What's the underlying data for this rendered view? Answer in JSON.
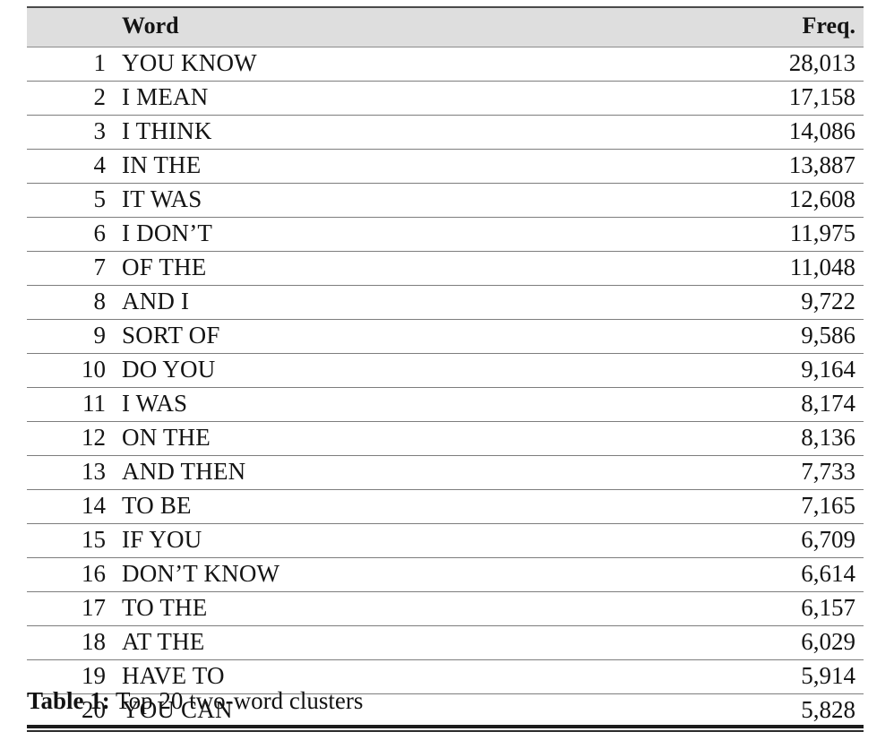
{
  "table": {
    "columns": {
      "rank": "",
      "word": "Word",
      "freq": "Freq."
    },
    "header_background": "#dedede",
    "rows": [
      {
        "rank": "1",
        "word": "YOU KNOW",
        "freq": "28,013"
      },
      {
        "rank": "2",
        "word": "I MEAN",
        "freq": "17,158"
      },
      {
        "rank": "3",
        "word": "I THINK",
        "freq": "14,086"
      },
      {
        "rank": "4",
        "word": "IN THE",
        "freq": "13,887"
      },
      {
        "rank": "5",
        "word": "IT WAS",
        "freq": "12,608"
      },
      {
        "rank": "6",
        "word": "I DON’T",
        "freq": "11,975"
      },
      {
        "rank": "7",
        "word": "OF THE",
        "freq": "11,048"
      },
      {
        "rank": "8",
        "word": "AND I",
        "freq": "9,722"
      },
      {
        "rank": "9",
        "word": "SORT OF",
        "freq": "9,586"
      },
      {
        "rank": "10",
        "word": "DO YOU",
        "freq": "9,164"
      },
      {
        "rank": "11",
        "word": "I WAS",
        "freq": "8,174"
      },
      {
        "rank": "12",
        "word": "ON THE",
        "freq": "8,136"
      },
      {
        "rank": "13",
        "word": "AND THEN",
        "freq": "7,733"
      },
      {
        "rank": "14",
        "word": "TO BE",
        "freq": "7,165"
      },
      {
        "rank": "15",
        "word": "IF YOU",
        "freq": "6,709"
      },
      {
        "rank": "16",
        "word": "DON’T KNOW",
        "freq": "6,614"
      },
      {
        "rank": "17",
        "word": "TO THE",
        "freq": "6,157"
      },
      {
        "rank": "18",
        "word": "AT THE",
        "freq": "6,029"
      },
      {
        "rank": "19",
        "word": "HAVE TO",
        "freq": "5,914"
      },
      {
        "rank": "20",
        "word": "YOU CAN",
        "freq": "5,828"
      }
    ]
  },
  "caption": {
    "label": "Table 1:",
    "text": "Top 20 two-word clusters"
  },
  "chart_data": {
    "type": "table",
    "title": "Table 1: Top 20 two-word clusters",
    "columns": [
      "",
      "Word",
      "Freq."
    ],
    "categories": [
      "YOU KNOW",
      "I MEAN",
      "I THINK",
      "IN THE",
      "IT WAS",
      "I DON’T",
      "OF THE",
      "AND I",
      "SORT OF",
      "DO YOU",
      "I WAS",
      "ON THE",
      "AND THEN",
      "TO BE",
      "IF YOU",
      "DON’T KNOW",
      "TO THE",
      "AT THE",
      "HAVE TO",
      "YOU CAN"
    ],
    "values": [
      28013,
      17158,
      14086,
      13887,
      12608,
      11975,
      11048,
      9722,
      9586,
      9164,
      8174,
      8136,
      7733,
      7165,
      6709,
      6614,
      6157,
      6029,
      5914,
      5828
    ],
    "xlabel": "Word",
    "ylabel": "Freq."
  }
}
